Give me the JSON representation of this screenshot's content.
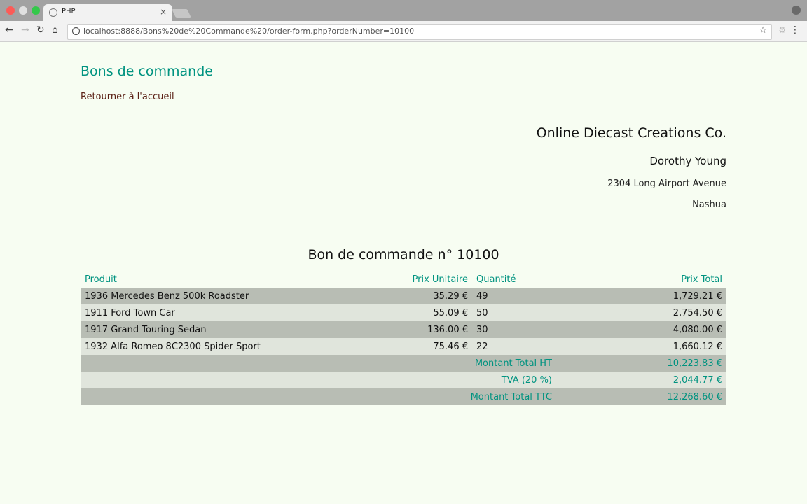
{
  "browser": {
    "tab_title": "PHP",
    "tab_close": "×",
    "url": "localhost:8888/Bons%20de%20Commande%20/order-form.php?orderNumber=10100"
  },
  "page": {
    "title": "Bons de commande",
    "home_link": "Retourner à l'accueil"
  },
  "customer": {
    "company": "Online Diecast Creations Co.",
    "contact": "Dorothy Young",
    "address": "2304 Long Airport Avenue",
    "city": "Nashua"
  },
  "order": {
    "title": "Bon de commande n° 10100",
    "headers": {
      "product": "Produit",
      "unit_price": "Prix Unitaire",
      "quantity": "Quantité",
      "total_price": "Prix Total"
    },
    "rows": [
      {
        "product": "1936 Mercedes Benz 500k Roadster",
        "unit_price": "35.29 €",
        "quantity": "49",
        "total": "1,729.21 €"
      },
      {
        "product": "1911 Ford Town Car",
        "unit_price": "55.09 €",
        "quantity": "50",
        "total": "2,754.50 €"
      },
      {
        "product": "1917 Grand Touring Sedan",
        "unit_price": "136.00 €",
        "quantity": "30",
        "total": "4,080.00 €"
      },
      {
        "product": "1932 Alfa Romeo 8C2300 Spider Sport",
        "unit_price": "75.46 €",
        "quantity": "22",
        "total": "1,660.12 €"
      }
    ],
    "totals": [
      {
        "label": "Montant Total HT",
        "value": "10,223.83 €"
      },
      {
        "label": "TVA (20 %)",
        "value": "2,044.77 €"
      },
      {
        "label": "Montant Total TTC",
        "value": "12,268.60 €"
      }
    ]
  },
  "colors": {
    "accent": "#009380",
    "link": "#5a1f14",
    "background": "#f7fdf2",
    "row_dark": "#b8bdb4",
    "row_light": "#e0e5dc"
  }
}
